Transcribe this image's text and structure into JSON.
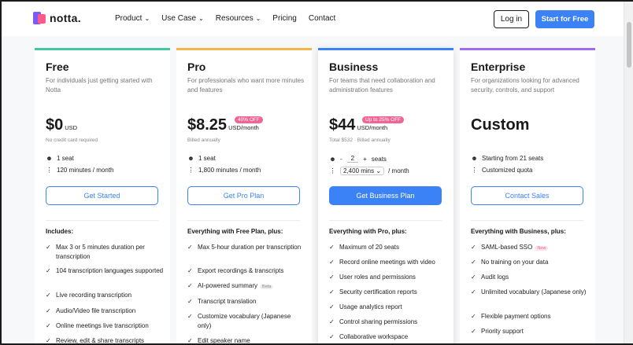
{
  "nav": {
    "logo_text": "notta.",
    "menu": [
      {
        "label": "Product",
        "has_dropdown": true
      },
      {
        "label": "Use Case",
        "has_dropdown": true
      },
      {
        "label": "Resources",
        "has_dropdown": true
      },
      {
        "label": "Pricing",
        "has_dropdown": false
      },
      {
        "label": "Contact",
        "has_dropdown": false
      }
    ],
    "login_label": "Log in",
    "start_label": "Start for Free"
  },
  "plans": {
    "free": {
      "title": "Free",
      "desc": "For individuals just getting started with Notta",
      "price": "$0",
      "unit": "USD",
      "sub": "No credit card required",
      "seats": "1 seat",
      "minutes": "120 minutes / month",
      "cta": "Get Started",
      "includes": "Includes:",
      "features": [
        "Max 3 or 5 minutes duration per transcription",
        "104 transcription languages supported",
        "Live recording transcription",
        "Audio/Video file transcription",
        "Online meetings live transcription",
        "Review, edit & share transcripts"
      ]
    },
    "pro": {
      "title": "Pro",
      "desc": "For professionals who want more minutes and features",
      "price": "$8.25",
      "unit": "USD/month",
      "badge": "40% OFF",
      "sub": "Billed annually",
      "seats": "1 seat",
      "minutes": "1,800 minutes / month",
      "cta": "Get Pro Plan",
      "includes": "Everything with Free Plan, plus:",
      "features": [
        "Max 5-hour duration per transcription",
        "Export recordings & transcripts",
        "AI-powered summary",
        "Transcript translation",
        "Customize vocabulary (Japanese only)",
        "Edit speaker name"
      ],
      "beta_label": "Beta"
    },
    "business": {
      "title": "Business",
      "desc": "For teams that need collaboration and administration features",
      "price": "$44",
      "unit": "USD/month",
      "badge": "Up to 25% OFF",
      "sub": "Total $532 · Billed annually",
      "seat_minus": "-",
      "seat_count": "2",
      "seat_plus": "+",
      "seats_label": "seats",
      "minutes_value": "2,400 mins",
      "minutes_suffix": "/ month",
      "cta": "Get Business Plan",
      "includes": "Everything with Pro, plus:",
      "features": [
        "Maximum of 20 seats",
        "Record online meetings with video",
        "User roles and permissions",
        "Security certification reports",
        "Usage analytics report",
        "Control sharing permissions",
        "Collaborative workspace"
      ]
    },
    "enterprise": {
      "title": "Enterprise",
      "desc": "For organizations looking for advanced security, controls, and support",
      "price": "Custom",
      "seats": "Starting from 21 seats",
      "minutes": "Customized quota",
      "cta": "Contact Sales",
      "includes": "Everything with Business, plus:",
      "features": [
        "SAML-based SSO",
        "No training on your data",
        "Audit logs",
        "Unlimited vocabulary (Japanese only)",
        "Flexible payment options",
        "Priority support"
      ],
      "new_label": "New"
    }
  },
  "colors": {
    "accent": "#3b82f6",
    "free": "#43c8a0",
    "pro": "#f5b54a",
    "business": "#3b82f6",
    "enterprise": "#9b6bf0",
    "badge": "#f06595"
  }
}
